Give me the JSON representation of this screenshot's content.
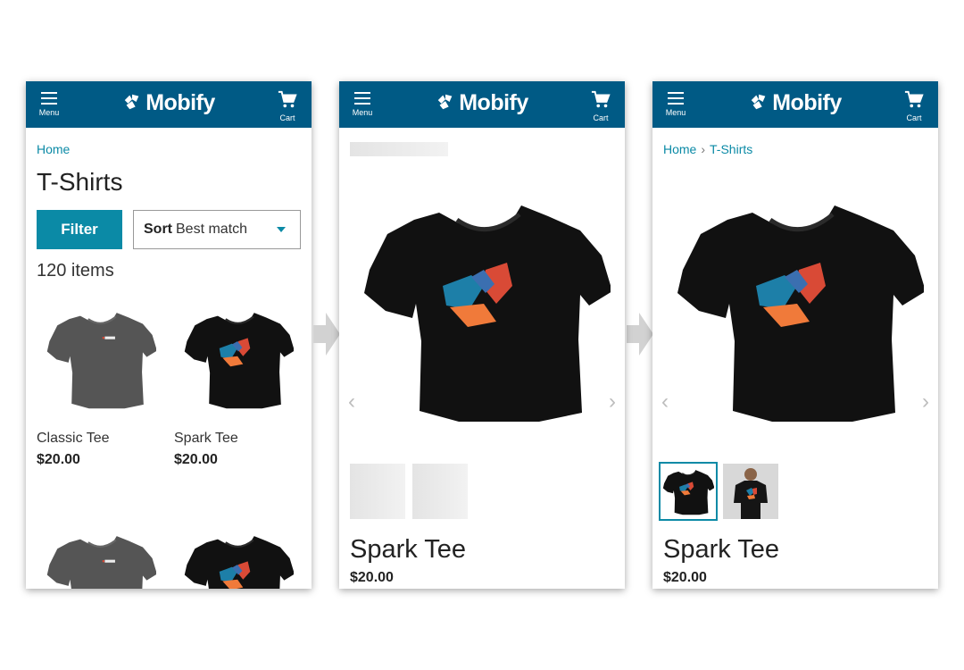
{
  "header": {
    "menu_label": "Menu",
    "brand": "Mobify",
    "cart_label": "Cart",
    "color": "#005a85"
  },
  "screen1": {
    "breadcrumb_home": "Home",
    "title": "T-Shirts",
    "filter_label": "Filter",
    "sort_label": "Sort",
    "sort_value": "Best match",
    "item_count": "120 items",
    "products": [
      {
        "name": "Classic Tee",
        "price": "$20.00"
      },
      {
        "name": "Spark Tee",
        "price": "$20.00"
      }
    ]
  },
  "screen2": {
    "product_name": "Spark Tee",
    "price": "$20.00"
  },
  "screen3": {
    "breadcrumb_home": "Home",
    "breadcrumb_current": "T-Shirts",
    "product_name": "Spark Tee",
    "price": "$20.00"
  },
  "colors": {
    "accent": "#0b8aa6",
    "header": "#005a85"
  }
}
